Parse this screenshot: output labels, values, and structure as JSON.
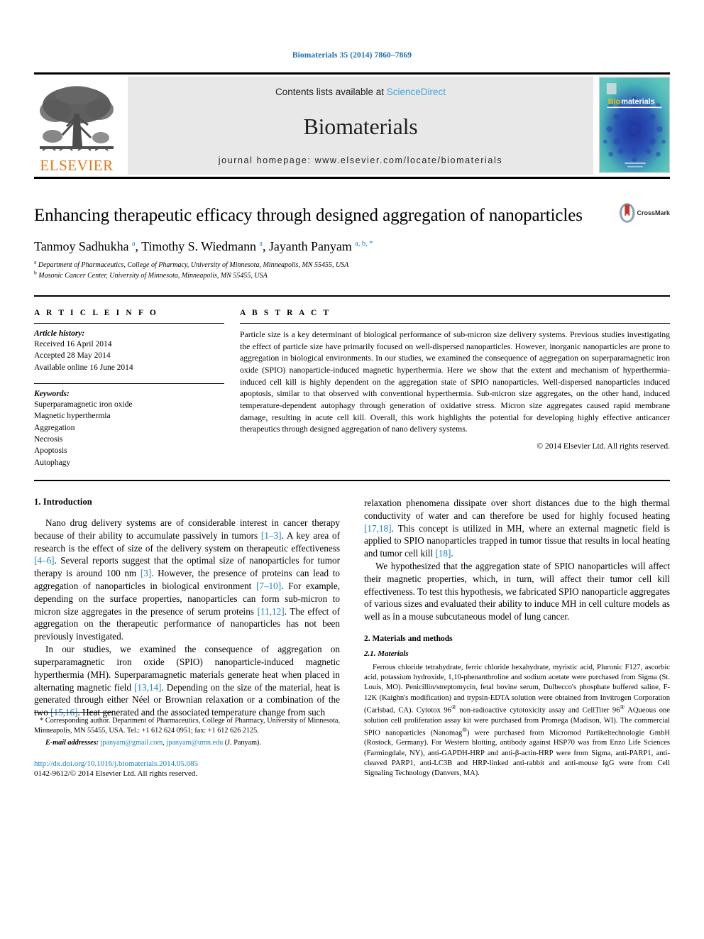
{
  "running_head": "Biomaterials 35 (2014) 7860–7869",
  "masthead": {
    "publisher_name": "ELSEVIER",
    "contents_prefix": "Contents lists available at ",
    "contents_link": "ScienceDirect",
    "journal_name": "Biomaterials",
    "homepage_line": "journal homepage: www.elsevier.com/locate/biomaterials",
    "cover_title_bio": "Bio",
    "cover_title_materials": "materials",
    "accent_blue": "#3ca5dc",
    "elsevier_orange": "#e87511"
  },
  "article": {
    "title": "Enhancing therapeutic efficacy through designed aggregation of nanoparticles",
    "crossmark_label": "CrossMark",
    "authors_html": "Tanmoy Sadhukha <sup>a</sup>, Timothy S. Wiedmann <sup>a</sup>, Jayanth Panyam <sup>a, b, *</sup>",
    "affiliations": [
      {
        "marker": "a",
        "text": "Department of Pharmaceutics, College of Pharmacy, University of Minnesota, Minneapolis, MN 55455, USA"
      },
      {
        "marker": "b",
        "text": "Masonic Cancer Center, University of Minnesota, Minneapolis, MN 55455, USA"
      }
    ]
  },
  "article_info": {
    "heading": "A R T I C L E   I N F O",
    "history_label": "Article history:",
    "history": [
      "Received 16 April 2014",
      "Accepted 28 May 2014",
      "Available online 16 June 2014"
    ],
    "keywords_label": "Keywords:",
    "keywords": [
      "Superparamagnetic iron oxide",
      "Magnetic hyperthermia",
      "Aggregation",
      "Necrosis",
      "Apoptosis",
      "Autophagy"
    ]
  },
  "abstract": {
    "heading": "A B S T R A C T",
    "text": "Particle size is a key determinant of biological performance of sub-micron size delivery systems. Previous studies investigating the effect of particle size have primarily focused on well-dispersed nanoparticles. However, inorganic nanoparticles are prone to aggregation in biological environments. In our studies, we examined the consequence of aggregation on superparamagnetic iron oxide (SPIO) nanoparticle-induced magnetic hyperthermia. Here we show that the extent and mechanism of hyperthermia-induced cell kill is highly dependent on the aggregation state of SPIO nanoparticles. Well-dispersed nanoparticles induced apoptosis, similar to that observed with conventional hyperthermia. Sub-micron size aggregates, on the other hand, induced temperature-dependent autophagy through generation of oxidative stress. Micron size aggregates caused rapid membrane damage, resulting in acute cell kill. Overall, this work highlights the potential for developing highly effective anticancer therapeutics through designed aggregation of nano delivery systems.",
    "copyright": "© 2014 Elsevier Ltd. All rights reserved."
  },
  "body": {
    "intro_heading": "1. Introduction",
    "intro_p1_html": "Nano drug delivery systems are of considerable interest in cancer therapy because of their ability to accumulate passively in tumors <span class=\"ref\">[1–3]</span>. A key area of research is the effect of size of the delivery system on therapeutic effectiveness <span class=\"ref\">[4–6]</span>. Several reports suggest that the optimal size of nanoparticles for tumor therapy is around 100 nm <span class=\"ref\">[3]</span>. However, the presence of proteins can lead to aggregation of nanoparticles in biological environment <span class=\"ref\">[7–10]</span>. For example, depending on the surface properties, nanoparticles can form sub-micron to micron size aggregates in the presence of serum proteins <span class=\"ref\">[11,12]</span>. The effect of aggregation on the therapeutic performance of nanoparticles has not been previously investigated.",
    "intro_p2_html": "In our studies, we examined the consequence of aggregation on superparamagnetic iron oxide (SPIO) nanoparticle-induced magnetic hyperthermia (MH). Superparamagnetic materials generate heat when placed in alternating magnetic field <span class=\"ref\">[13,14]</span>. Depending on the size of the material, heat is generated through either Néel or Brownian relaxation or a combination of the two <span class=\"ref\">[15,16]</span>. Heat generated and the associated temperature change from such",
    "intro_p3_html": "relaxation phenomena dissipate over short distances due to the high thermal conductivity of water and can therefore be used for highly focused heating <span class=\"ref\">[17,18]</span>. This concept is utilized in MH, where an external magnetic field is applied to SPIO nanoparticles trapped in tumor tissue that results in local heating and tumor cell kill <span class=\"ref\">[18]</span>.",
    "intro_p4_html": "We hypothesized that the aggregation state of SPIO nanoparticles will affect their magnetic properties, which, in turn, will affect their tumor cell kill effectiveness. To test this hypothesis, we fabricated SPIO nanoparticle aggregates of various sizes and evaluated their ability to induce MH in cell culture models as well as in a mouse subcutaneous model of lung cancer.",
    "methods_heading": "2. Materials and methods",
    "materials_heading": "2.1. Materials",
    "materials_p_html": "Ferrous chloride tetrahydrate, ferric chloride hexahydrate, myristic acid, Pluronic F127, ascorbic acid, potassium hydroxide, 1,10-phenanthroline and sodium acetate were purchased from Sigma (St. Louis, MO). Penicillin/streptomycin, fetal bovine serum, Dulbecco's phosphate buffered saline, F-12K (Kaighn's modification) and trypsin-EDTA solution were obtained from Invitrogen Corporation (Carlsbad, CA). Cytotox 96<sup>&reg;</sup> non-radioactive cytotoxicity assay and CellTiter 96<sup>&reg;</sup> AQueous one solution cell proliferation assay kit were purchased from Promega (Madison, WI). The commercial SPIO nanoparticles (Nanomag<sup>&reg;</sup>) were purchased from Micromod Partikeltechnologie GmbH (Rostock, Germany). For Western blotting, antibody against HSP70 was from Enzo Life Sciences (Farmingdale, NY), anti-GAPDH-HRP and anti-β-actin-HRP were from Sigma, anti-PARP1, anti-cleaved PARP1, anti-LC3B and HRP-linked anti-rabbit and anti-mouse IgG were from Cell Signaling Technology (Danvers, MA)."
  },
  "footnote": {
    "corresponding_html": "* Corresponding author. Department of Pharmaceutics, College of Pharmacy, University of Minnesota, Minneapolis, MN 55455, USA. Tel.: +1 612 624 0951; fax: +1 612 626 2125.",
    "email_label": "E-mail addresses:",
    "email_1": "jpanyam@gmail.com",
    "email_2": "jpanyam@umn.edu",
    "email_suffix": "(J. Panyam).",
    "doi": "http://dx.doi.org/10.1016/j.biomaterials.2014.05.085",
    "issn_line": "0142-9612/© 2014 Elsevier Ltd. All rights reserved."
  }
}
